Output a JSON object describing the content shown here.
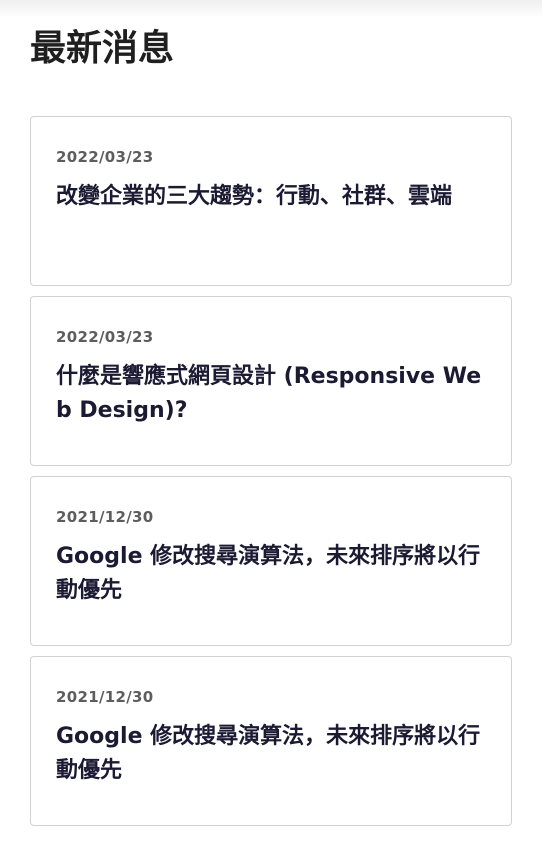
{
  "page": {
    "title": "最新消息"
  },
  "news": [
    {
      "date": "2022/03/23",
      "title": "改變企業的三大趨勢：行動、社群、雲端"
    },
    {
      "date": "2022/03/23",
      "title": "什麼是響應式網頁設計 (Responsive Web Design)?"
    },
    {
      "date": "2021/12/30",
      "title": "Google 修改搜尋演算法，未來排序將以行動優先"
    },
    {
      "date": "2021/12/30",
      "title": "Google 修改搜尋演算法，未來排序將以行動優先"
    }
  ]
}
